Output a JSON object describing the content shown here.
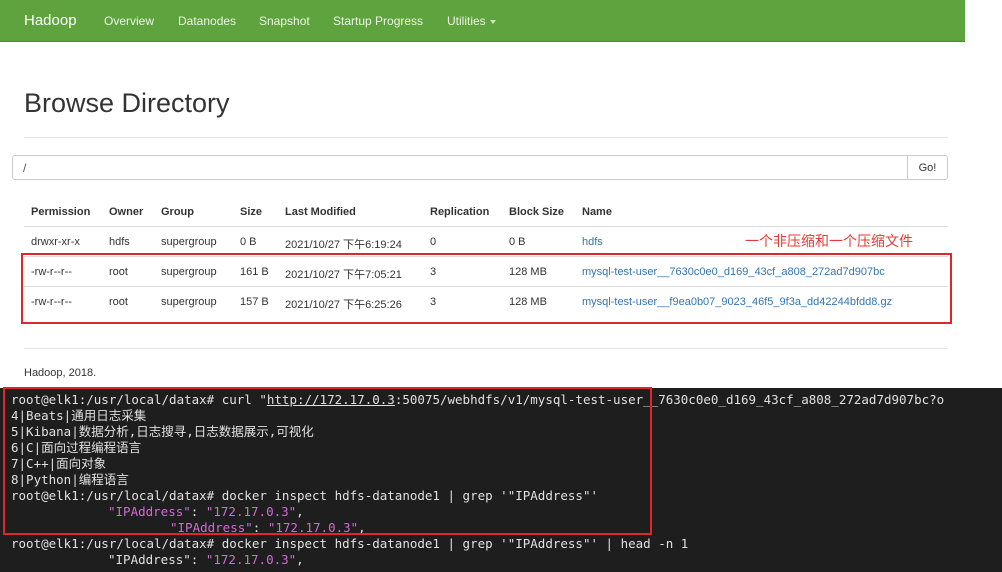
{
  "navbar": {
    "brand": "Hadoop",
    "items": [
      "Overview",
      "Datanodes",
      "Snapshot",
      "Startup Progress",
      "Utilities"
    ]
  },
  "page_title": "Browse Directory",
  "path_input": {
    "value": "/"
  },
  "go_button": "Go!",
  "table": {
    "headers": [
      "Permission",
      "Owner",
      "Group",
      "Size",
      "Last Modified",
      "Replication",
      "Block Size",
      "Name"
    ],
    "rows": [
      [
        "drwxr-xr-x",
        "hdfs",
        "supergroup",
        "0 B",
        "2021/10/27 下午6:19:24",
        "0",
        "0 B",
        "hdfs"
      ],
      [
        "-rw-r--r--",
        "root",
        "supergroup",
        "161 B",
        "2021/10/27 下午7:05:21",
        "3",
        "128 MB",
        "mysql-test-user__7630c0e0_d169_43cf_a808_272ad7d907bc"
      ],
      [
        "-rw-r--r--",
        "root",
        "supergroup",
        "157 B",
        "2021/10/27 下午6:25:26",
        "3",
        "128 MB",
        "mysql-test-user__f9ea0b07_9023_46f5_9f3a_dd42244bfdd8.gz"
      ]
    ]
  },
  "annotation": "一个非压缩和一个压缩文件",
  "footer": "Hadoop, 2018.",
  "terminal": {
    "l1_prompt": "root@elk1:/usr/local/datax# curl \"",
    "l1_url": "http://172.17.0.3",
    "l1_rest": ":50075/webhdfs/v1/mysql-test-user__7630c0e0_d169_43cf_a808_272ad7d907bc?o",
    "l2": "4|Beats|通用日志采集",
    "l3": "5|Kibana|数据分析,日志搜寻,日志数据展示,可视化",
    "l4": "6|C|面向过程编程语言",
    "l5": "7|C++|面向对象",
    "l6": "8|Python|编程语言",
    "l7": "root@elk1:/usr/local/datax# docker inspect hdfs-datanode1 | grep '\"IPAddress\"'",
    "l8_key": "\"IPAddress\"",
    "l8_sep": ": ",
    "l8_val": "\"172.17.0.3\"",
    "l8_end": ",",
    "l9_key": "\"IPAddress\"",
    "l9_sep": ": ",
    "l9_val": "\"172.17.0.3\"",
    "l9_end": ",",
    "l10": "root@elk1:/usr/local/datax# docker inspect hdfs-datanode1 | grep '\"IPAddress\"' | head -n 1",
    "l11_key": "\"IPAddress\"",
    "l11_sep": ": ",
    "l11_val": "\"172.17.0.3\"",
    "l11_end": ","
  },
  "colors": {
    "navbar": "#5fa33e",
    "link": "#3276b1",
    "annotation": "#e53935",
    "terminal_bg": "#1e1e1e",
    "terminal_highlight": "#d36ad6"
  }
}
